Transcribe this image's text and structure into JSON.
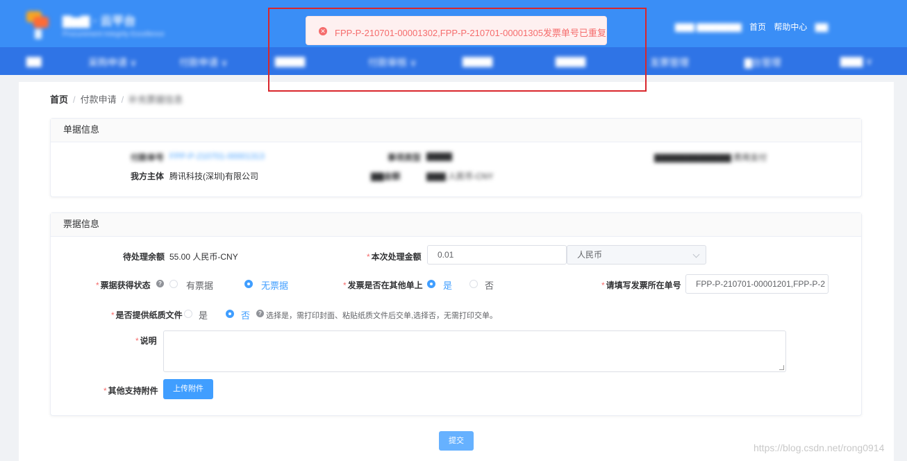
{
  "header": {
    "brand_title": "▇▆▇ · 云平台",
    "brand_sub": "Procurement Integrity Excellence",
    "top_links": [
      "▇▇▇ ▇▇▇▇▇▇▇",
      "首页",
      "帮助中心",
      "▇▇"
    ]
  },
  "nav": {
    "items": [
      "▇▇",
      "采购申请 ∨",
      "付款申请 ∨",
      "▇▇▇▇",
      "付款审核 ∨",
      "▇▇▇▇",
      "▇▇▇▇",
      "发票管理",
      "▇台管理",
      "▇▇▇ ∨"
    ]
  },
  "toast": {
    "icon": "close-circle-icon",
    "message": "FPP-P-210701-00001302,FPP-P-210701-00001305发票单号已重复"
  },
  "breadcrumb": {
    "items": [
      "首页",
      "付款申请",
      "补充票据信息"
    ]
  },
  "order_info": {
    "title": "单据信息",
    "payee_label": "付款单号",
    "payee_value": "FPP-P-210701-00001313",
    "company_label": "我方主体",
    "company_value": "腾讯科技(深圳)有限公司",
    "matter_label": "事项类型",
    "matter_value": "▇▇▇▇",
    "amount_label": "▇▇金额",
    "amount_value": "▇▇▇ 人民币-CNY",
    "right_text": "▇▇▇▇▇▇▇▇▇▇▇▇ 费用支付"
  },
  "invoice_info": {
    "title": "票据信息",
    "pending_label": "待处理余额",
    "pending_value": "55.00 人民币-CNY",
    "amount_label": "本次处理金额",
    "amount_value": "0.01",
    "currency_value": "人民币",
    "status_label": "票据获得状态",
    "status_options": [
      "有票据",
      "无票据"
    ],
    "other_label": "发票是否在其他单上",
    "other_options": [
      "是",
      "否"
    ],
    "invoice_no_label": "请填写发票所在单号",
    "invoice_no_value": "FPP-P-210701-00001201,FPP-P-2",
    "paper_label": "是否提供纸质文件",
    "paper_options": [
      "是",
      "否"
    ],
    "paper_hint": "选择是，需打印封面、粘贴纸质文件后交单,选择否，无需打印交单。",
    "desc_label": "说明",
    "attach_label": "其他支持附件",
    "upload_button": "上传附件"
  },
  "submit_button": "提交",
  "watermark": "https://blog.csdn.net/rong0914",
  "colors": {
    "header": "#3a8ef6",
    "nav": "#2f74e6",
    "primary": "#409eff",
    "error": "#f56c6c",
    "highlight": "#d9262b"
  }
}
